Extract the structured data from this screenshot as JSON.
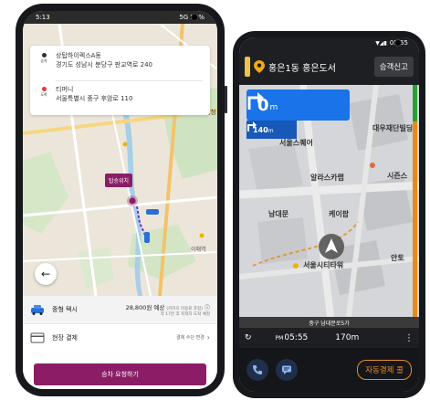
{
  "left_phone": {
    "status_bar": {
      "time": "5:13",
      "right": "5G 59%"
    },
    "origin": {
      "tag": "승차",
      "name": "상탑하이렉스A동",
      "address": "경기도 성남시 분당구 판교역로 240"
    },
    "destination": {
      "tag": "도착",
      "name": "티머니",
      "address": "서울특별시 중구 후암로 110"
    },
    "map_labels": {
      "label_1": "성남시청",
      "label_2": "이매역"
    },
    "pickup_label": "탑승위치",
    "taxi": {
      "name": "중형 택시",
      "price": "28,800원 예상",
      "price_note": "(카카오 이용료 포함)",
      "eta": "약 17분 후 목적지 도착 예정"
    },
    "payment": {
      "name": "현장 결제",
      "note": "결제 수단 변경"
    },
    "call_button": "승차 요청하기",
    "colors": {
      "brand": "#8b1d66"
    }
  },
  "right_phone": {
    "status_bar": {
      "time": "05:55"
    },
    "destination_title": "홍은1동 홍은도서",
    "report_button": "승객신고",
    "turn": {
      "distance": "0",
      "unit": "m"
    },
    "next_turn": {
      "distance": "140",
      "unit": "m"
    },
    "pois": {
      "p1": "서울스퀘어",
      "p2": "대우재단빌딩",
      "p3": "알라스카랩",
      "p4": "시즌스",
      "p5": "남대문",
      "p6": "케이팝",
      "p7": "서울시티타워",
      "p8": "안토"
    },
    "street_name": "중구 남대문로5가",
    "arrival": {
      "ampm": "PM",
      "time": "05:55",
      "distance": "170m"
    },
    "autopay_button": "자동결제 콜",
    "colors": {
      "turn_panel": "#1a73e8",
      "autopay": "#e98c2a"
    }
  }
}
